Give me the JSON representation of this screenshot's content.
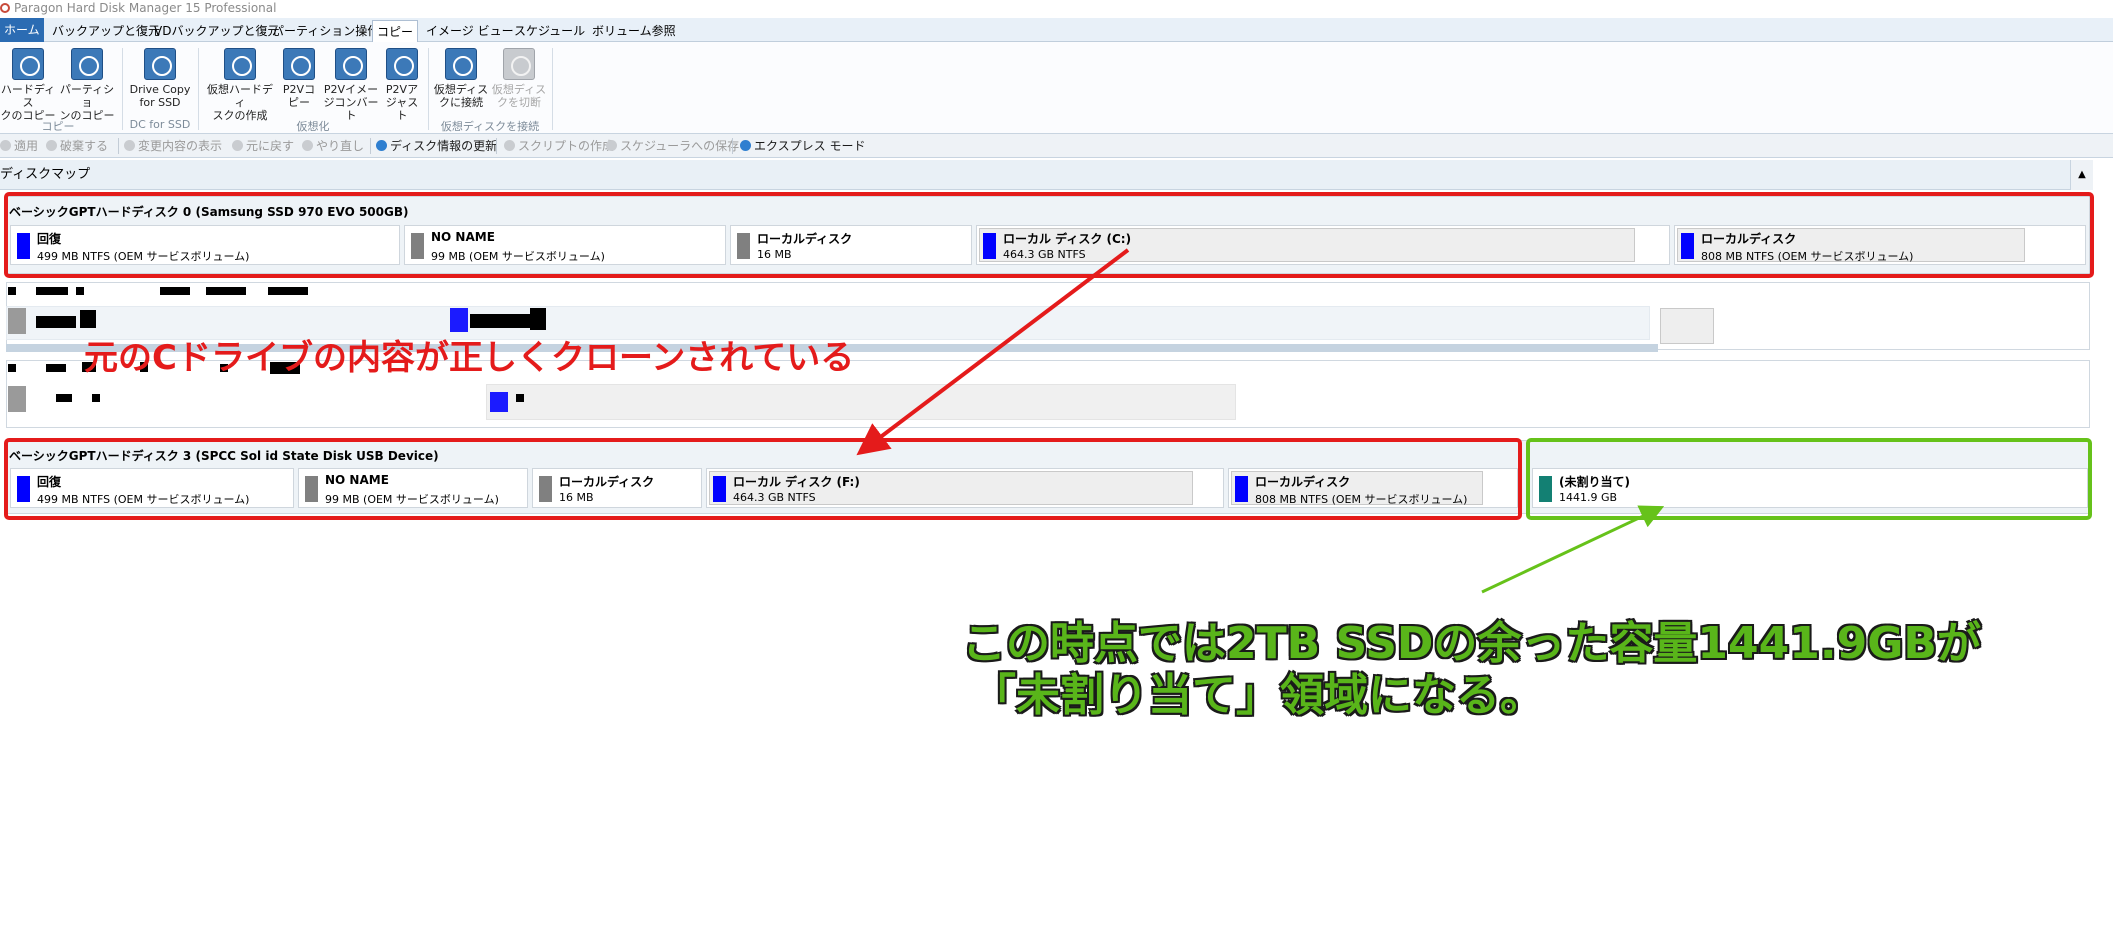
{
  "window": {
    "title": "Paragon Hard Disk Manager 15 Professional"
  },
  "menu": {
    "tabs": [
      "ホーム",
      "バックアップと復元",
      "VDバックアップと復元",
      "パーティション操作",
      "コピー",
      "イメージ ビュー",
      "スケジュール",
      "ボリューム参照"
    ],
    "active": "コピー"
  },
  "ribbon": {
    "buttons": [
      {
        "line1": "ハードディス",
        "line2": "クのコピー",
        "icon": "disk-copy-icon"
      },
      {
        "line1": "パーティショ",
        "line2": "ンのコピー",
        "icon": "partition-copy-icon"
      },
      {
        "line1": "Drive Copy",
        "line2": "for SSD",
        "icon": "drive-copy-ssd-icon"
      },
      {
        "line1": "仮想ハードディ",
        "line2": "スクの作成",
        "icon": "virtual-disk-create-icon"
      },
      {
        "line1": "P2Vコ",
        "line2": "ピー",
        "icon": "p2v-copy-icon"
      },
      {
        "line1": "P2Vイメー",
        "line2": "ジコンバート",
        "icon": "p2v-image-convert-icon"
      },
      {
        "line1": "P2Vア",
        "line2": "ジャスト",
        "icon": "p2v-adjust-icon"
      },
      {
        "line1": "仮想ディス",
        "line2": "クに接続",
        "icon": "virtual-disk-connect-icon"
      },
      {
        "line1": "仮想ディス",
        "line2": "クを切断",
        "icon": "virtual-disk-disconnect-icon"
      }
    ],
    "groups": [
      "コピー",
      "DC for SSD",
      "仮想化",
      "仮想ディスクを接続"
    ]
  },
  "toolbar": {
    "apply": "適用",
    "discard": "破棄する",
    "show_changes": "変更内容の表示",
    "undo": "元に戻す",
    "redo": "やり直し",
    "refresh": "ディスク情報の更新",
    "create_script": "スクリプトの作成",
    "save_scheduler": "スケジューラへの保存",
    "express_mode": "エクスプレス モード"
  },
  "diskmap": {
    "header": "ディスクマップ",
    "collapse_glyph": "▲",
    "disk0": {
      "title": "ベーシックGPTハードディスク 0 (Samsung SSD 970 EVO 500GB)",
      "partitions": [
        {
          "name": "回復",
          "info": "499 MB NTFS (OEM サービスボリューム)",
          "color": "#0000ff"
        },
        {
          "name": "NO NAME",
          "info": "99 MB (OEM サービスボリューム)",
          "color": "#808080"
        },
        {
          "name": "ローカルディスク",
          "info": "16 MB",
          "color": "#808080"
        },
        {
          "name": "ローカル ディスク (C:)",
          "info": "464.3 GB NTFS",
          "color": "#0000ff"
        },
        {
          "name": "ローカルディスク",
          "info": "808 MB NTFS (OEM サービスボリューム)",
          "color": "#0000ff"
        }
      ]
    },
    "disk3": {
      "title": "ベーシックGPTハードディスク 3 (SPCC Sol id State Disk USB Device)",
      "partitions": [
        {
          "name": "回復",
          "info": "499 MB NTFS (OEM サービスボリューム)",
          "color": "#0000ff"
        },
        {
          "name": "NO NAME",
          "info": "99 MB (OEM サービスボリューム)",
          "color": "#808080"
        },
        {
          "name": "ローカルディスク",
          "info": "16 MB",
          "color": "#808080"
        },
        {
          "name": "ローカル ディスク (F:)",
          "info": "464.3 GB NTFS",
          "color": "#0000ff"
        },
        {
          "name": "ローカルディスク",
          "info": "808 MB NTFS (OEM サービスボリューム)",
          "color": "#0000ff"
        },
        {
          "name": "(未割り当て)",
          "info": "1441.9 GB",
          "color": "#138073"
        }
      ]
    }
  },
  "annotations": {
    "red_note": "元のCドライブの内容が正しくクローンされている",
    "green_line1": "この時点では2TB SSDの余った容量1441.9GBが",
    "green_line2": "「未割り当て」領域になる。",
    "red_color": "#e41b1b",
    "green_color": "#66c21a"
  }
}
